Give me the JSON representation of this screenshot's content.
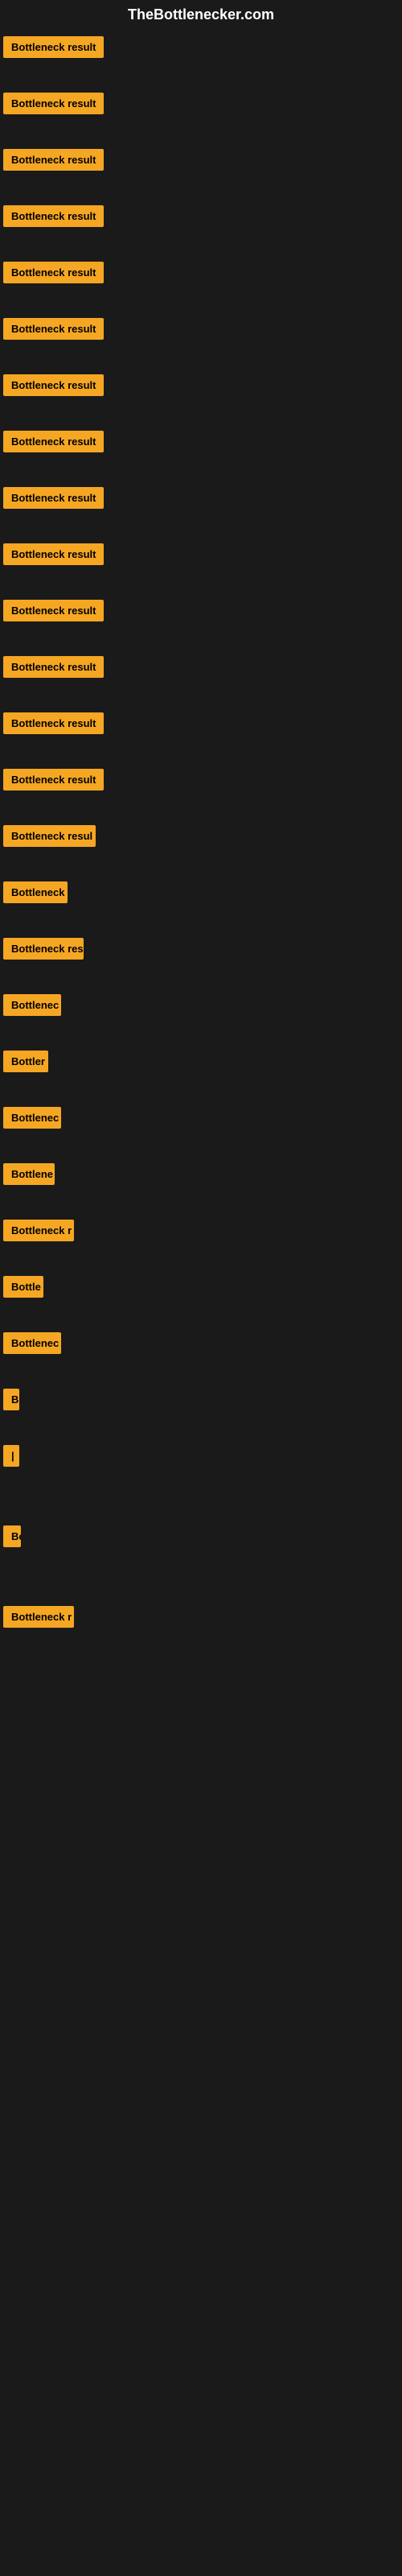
{
  "site": {
    "title": "TheBottlenecker.com"
  },
  "items": [
    {
      "id": 1,
      "label": "Bottleneck result",
      "width": 130
    },
    {
      "id": 2,
      "label": "Bottleneck result",
      "width": 130
    },
    {
      "id": 3,
      "label": "Bottleneck result",
      "width": 130
    },
    {
      "id": 4,
      "label": "Bottleneck result",
      "width": 130
    },
    {
      "id": 5,
      "label": "Bottleneck result",
      "width": 130
    },
    {
      "id": 6,
      "label": "Bottleneck result",
      "width": 130
    },
    {
      "id": 7,
      "label": "Bottleneck result",
      "width": 130
    },
    {
      "id": 8,
      "label": "Bottleneck result",
      "width": 130
    },
    {
      "id": 9,
      "label": "Bottleneck result",
      "width": 130
    },
    {
      "id": 10,
      "label": "Bottleneck result",
      "width": 130
    },
    {
      "id": 11,
      "label": "Bottleneck result",
      "width": 130
    },
    {
      "id": 12,
      "label": "Bottleneck result",
      "width": 130
    },
    {
      "id": 13,
      "label": "Bottleneck result",
      "width": 130
    },
    {
      "id": 14,
      "label": "Bottleneck result",
      "width": 130
    },
    {
      "id": 15,
      "label": "Bottleneck resul",
      "width": 115
    },
    {
      "id": 16,
      "label": "Bottleneck",
      "width": 80
    },
    {
      "id": 17,
      "label": "Bottleneck res",
      "width": 100
    },
    {
      "id": 18,
      "label": "Bottlenec",
      "width": 72
    },
    {
      "id": 19,
      "label": "Bottler",
      "width": 56
    },
    {
      "id": 20,
      "label": "Bottlenec",
      "width": 72
    },
    {
      "id": 21,
      "label": "Bottlene",
      "width": 64
    },
    {
      "id": 22,
      "label": "Bottleneck r",
      "width": 88
    },
    {
      "id": 23,
      "label": "Bottle",
      "width": 50
    },
    {
      "id": 24,
      "label": "Bottlenec",
      "width": 72
    },
    {
      "id": 25,
      "label": "B",
      "width": 18
    },
    {
      "id": 26,
      "label": "|",
      "width": 10
    },
    {
      "id": 27,
      "label": "",
      "width": 0,
      "gap": true
    },
    {
      "id": 28,
      "label": "",
      "width": 0,
      "gap": true
    },
    {
      "id": 29,
      "label": "",
      "width": 0,
      "gap": true
    },
    {
      "id": 30,
      "label": "Bo",
      "width": 22
    },
    {
      "id": 31,
      "label": "",
      "width": 0,
      "gap": true
    },
    {
      "id": 32,
      "label": "",
      "width": 0,
      "gap": true
    },
    {
      "id": 33,
      "label": "Bottleneck r",
      "width": 88
    },
    {
      "id": 34,
      "label": "",
      "width": 0,
      "gap": true
    },
    {
      "id": 35,
      "label": "",
      "width": 0,
      "gap": true
    }
  ]
}
